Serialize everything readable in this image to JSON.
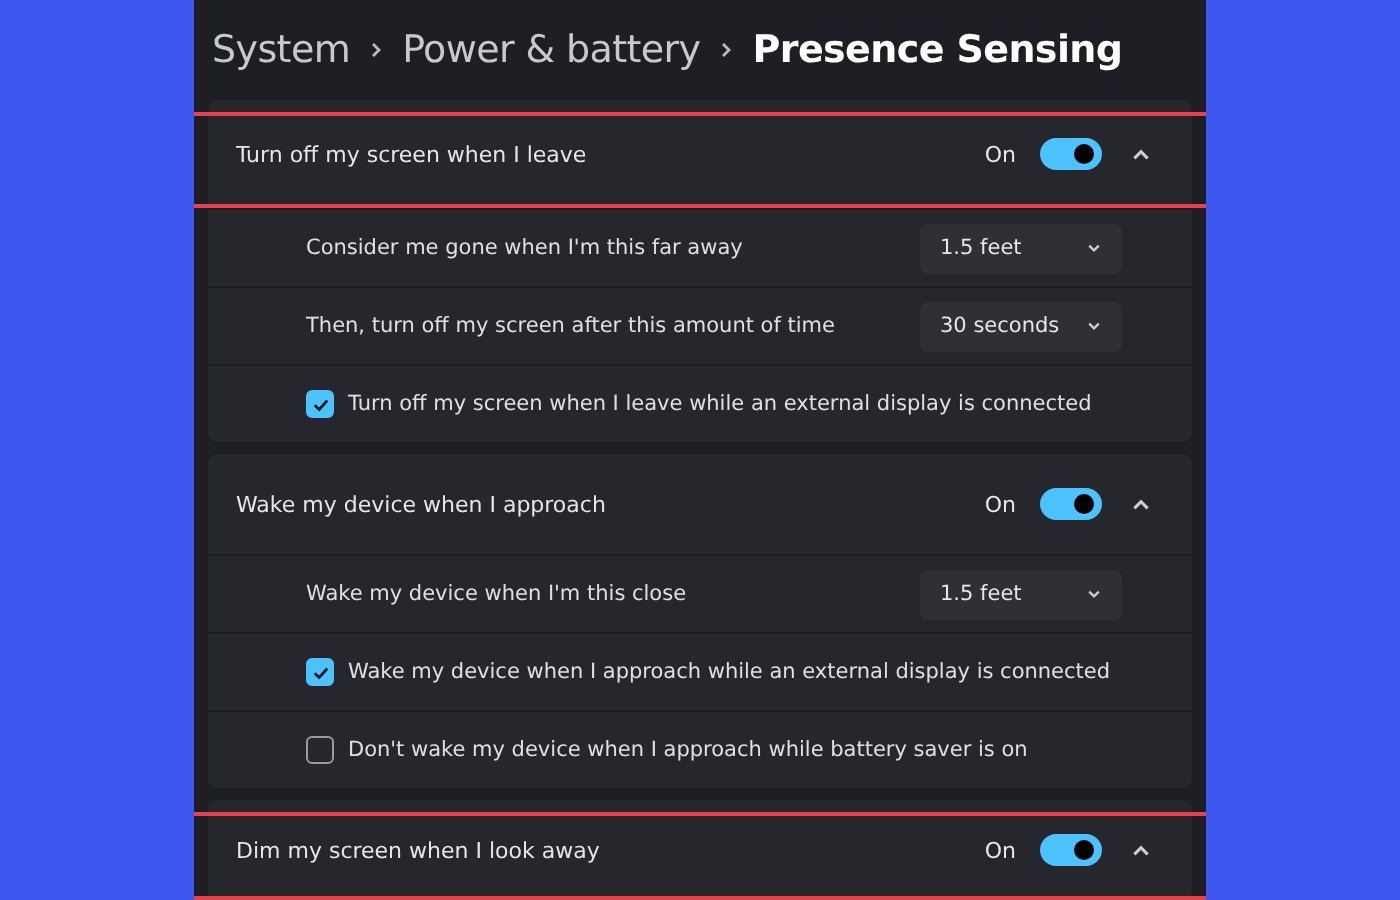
{
  "breadcrumb": [
    {
      "label": "System",
      "current": false
    },
    {
      "label": "Power & battery",
      "current": false
    },
    {
      "label": "Presence Sensing",
      "current": true
    }
  ],
  "sections": [
    {
      "title": "Turn off my screen when I leave",
      "highlighted": true,
      "toggle_label": "On",
      "on": true,
      "expanded": true,
      "children": [
        {
          "kind": "dropdown",
          "label": "Consider me gone when I'm this far away",
          "value": "1.5 feet"
        },
        {
          "kind": "dropdown",
          "label": "Then, turn off my screen after this amount of time",
          "value": "30 seconds"
        },
        {
          "kind": "checkbox",
          "label": "Turn off my screen when I leave while an external display is connected",
          "checked": true
        }
      ]
    },
    {
      "title": "Wake my device when I approach",
      "highlighted": false,
      "toggle_label": "On",
      "on": true,
      "expanded": true,
      "children": [
        {
          "kind": "dropdown",
          "label": "Wake my device when I'm this close",
          "value": "1.5 feet"
        },
        {
          "kind": "checkbox",
          "label": "Wake my device when I approach while an external display is connected",
          "checked": true
        },
        {
          "kind": "checkbox",
          "label": "Don't wake my device when I approach while battery saver is on",
          "checked": false
        }
      ]
    },
    {
      "title": "Dim my screen when I look away",
      "highlighted": true,
      "toggle_label": "On",
      "on": true,
      "expanded": true
    }
  ]
}
